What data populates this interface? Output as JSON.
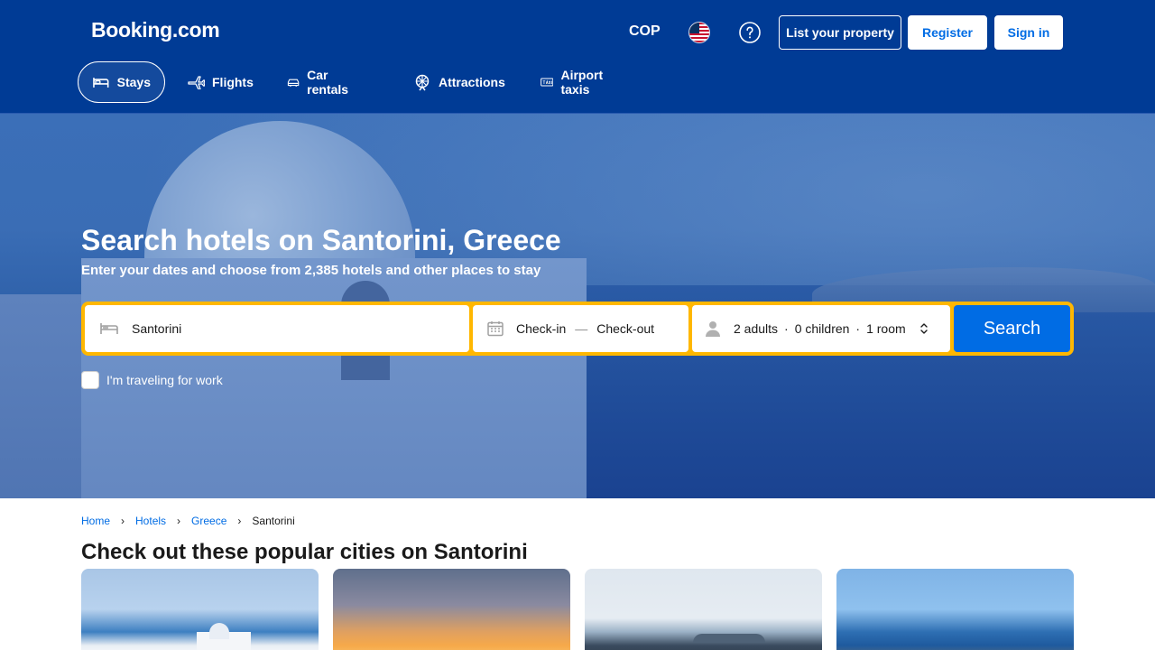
{
  "header": {
    "logo": "Booking.com",
    "currency": "COP",
    "list_property": "List your property",
    "register": "Register",
    "sign_in": "Sign in"
  },
  "nav": {
    "items": [
      {
        "label": "Stays",
        "icon": "bed-icon",
        "active": true
      },
      {
        "label": "Flights",
        "icon": "plane-icon"
      },
      {
        "label": "Car rentals",
        "icon": "car-icon"
      },
      {
        "label": "Attractions",
        "icon": "ferris-wheel-icon"
      },
      {
        "label": "Airport taxis",
        "icon": "taxi-icon"
      }
    ]
  },
  "hero": {
    "title": "Search hotels on Santorini, Greece",
    "subtitle": "Enter your dates and choose from 2,385 hotels and other places to stay"
  },
  "search": {
    "destination": "Santorini",
    "check_in": "Check-in",
    "check_out": "Check-out",
    "adults": "2 adults",
    "children": "0 children",
    "rooms": "1 room",
    "button": "Search",
    "work_travel": "I'm traveling for work"
  },
  "breadcrumb": {
    "items": [
      "Home",
      "Hotels",
      "Greece"
    ],
    "current": "Santorini"
  },
  "section": {
    "title": "Check out these popular cities on Santorini"
  },
  "colors": {
    "brand": "#003b95",
    "accent": "#006ce4",
    "search_border": "#ffb700"
  }
}
